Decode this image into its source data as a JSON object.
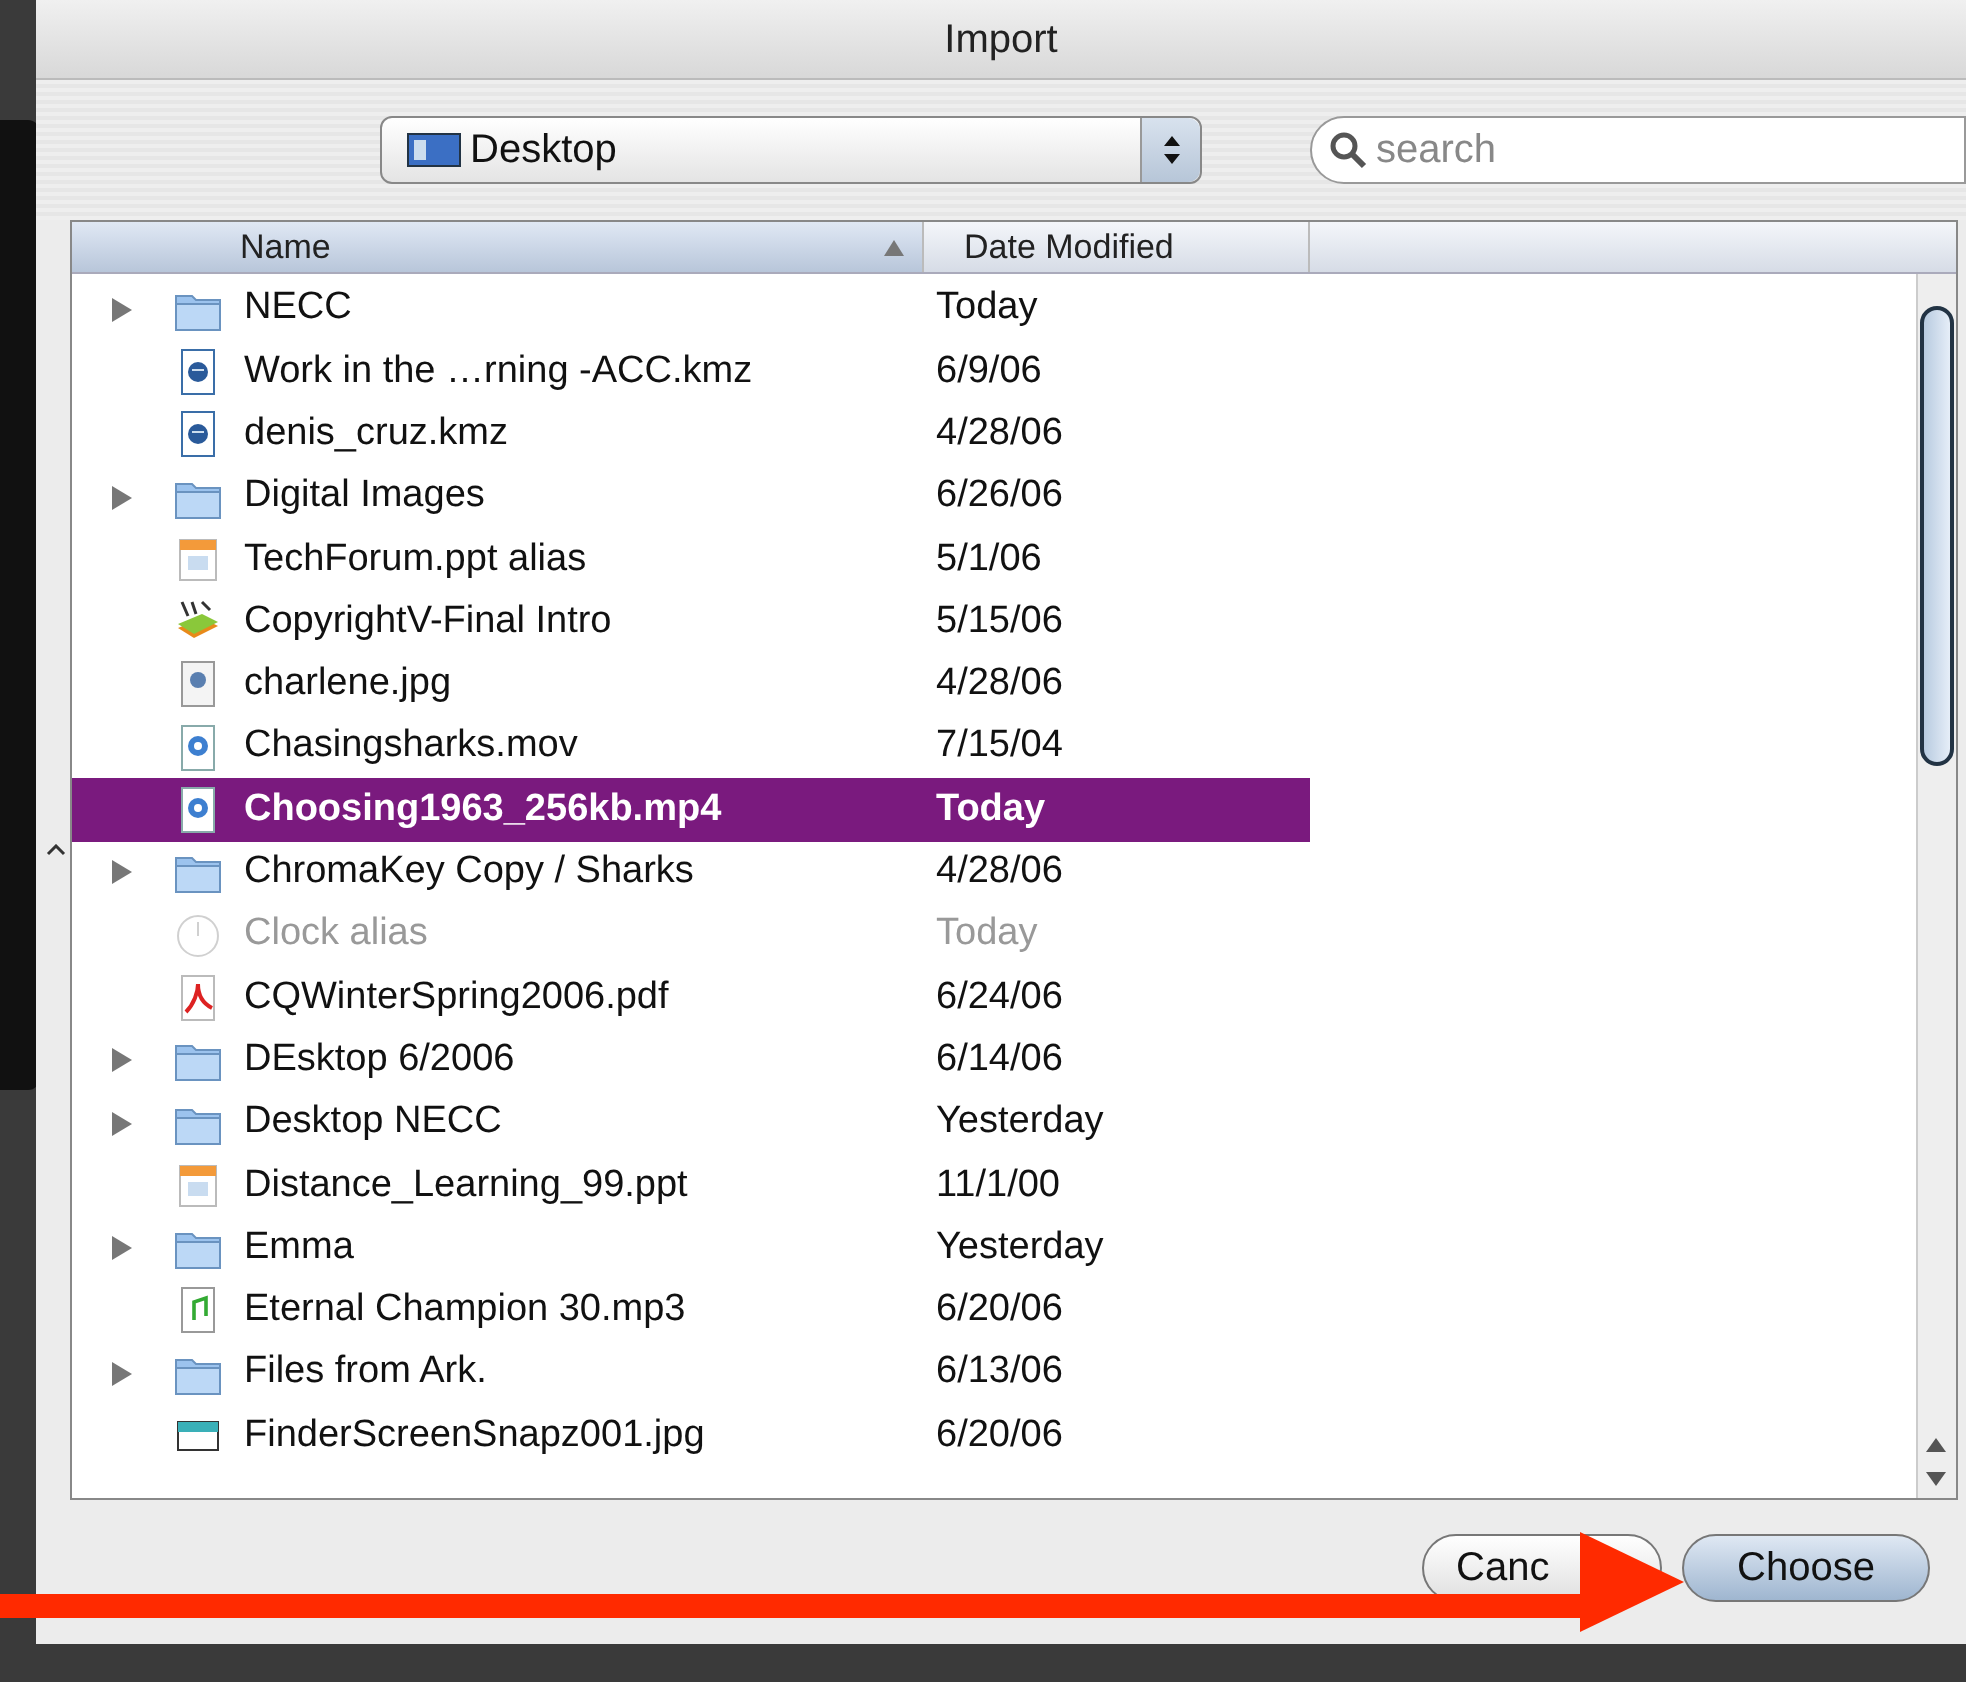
{
  "window": {
    "title": "Import"
  },
  "location": {
    "value": "Desktop"
  },
  "search": {
    "placeholder": "search"
  },
  "table": {
    "columns": [
      {
        "label": "Name",
        "sorted": true
      },
      {
        "label": "Date Modified",
        "sorted": false
      }
    ],
    "rows": [
      {
        "name": "NECC",
        "date": "Today",
        "kind": "folder",
        "expandable": true,
        "selected": false,
        "disabled": false
      },
      {
        "name": "Work in the …rning -ACC.kmz",
        "date": "6/9/06",
        "kind": "kmz",
        "expandable": false,
        "selected": false,
        "disabled": false
      },
      {
        "name": "denis_cruz.kmz",
        "date": "4/28/06",
        "kind": "kmz",
        "expandable": false,
        "selected": false,
        "disabled": false
      },
      {
        "name": "Digital Images",
        "date": "6/26/06",
        "kind": "folder",
        "expandable": true,
        "selected": false,
        "disabled": false
      },
      {
        "name": "TechForum.ppt alias",
        "date": "5/1/06",
        "kind": "slides",
        "expandable": false,
        "selected": false,
        "disabled": false
      },
      {
        "name": "CopyrightV-Final Intro",
        "date": "5/15/06",
        "kind": "app",
        "expandable": false,
        "selected": false,
        "disabled": false
      },
      {
        "name": "charlene.jpg",
        "date": "4/28/06",
        "kind": "image",
        "expandable": false,
        "selected": false,
        "disabled": false
      },
      {
        "name": "Chasingsharks.mov",
        "date": "7/15/04",
        "kind": "movie",
        "expandable": false,
        "selected": false,
        "disabled": false
      },
      {
        "name": "Choosing1963_256kb.mp4",
        "date": "Today",
        "kind": "movie",
        "expandable": false,
        "selected": true,
        "disabled": false
      },
      {
        "name": "ChromaKey Copy / Sharks",
        "date": "4/28/06",
        "kind": "folder",
        "expandable": true,
        "selected": false,
        "disabled": false
      },
      {
        "name": "Clock alias",
        "date": "Today",
        "kind": "clock",
        "expandable": false,
        "selected": false,
        "disabled": true
      },
      {
        "name": "CQWinterSpring2006.pdf",
        "date": "6/24/06",
        "kind": "pdf",
        "expandable": false,
        "selected": false,
        "disabled": false
      },
      {
        "name": "DEsktop 6/2006",
        "date": "6/14/06",
        "kind": "folder",
        "expandable": true,
        "selected": false,
        "disabled": false
      },
      {
        "name": "Desktop NECC",
        "date": "Yesterday",
        "kind": "folder",
        "expandable": true,
        "selected": false,
        "disabled": false
      },
      {
        "name": "Distance_Learning_99.ppt",
        "date": "11/1/00",
        "kind": "slides",
        "expandable": false,
        "selected": false,
        "disabled": false
      },
      {
        "name": "Emma",
        "date": "Yesterday",
        "kind": "folder",
        "expandable": true,
        "selected": false,
        "disabled": false
      },
      {
        "name": "Eternal Champion 30.mp3",
        "date": "6/20/06",
        "kind": "audio",
        "expandable": false,
        "selected": false,
        "disabled": false
      },
      {
        "name": "Files from Ark.",
        "date": "6/13/06",
        "kind": "folder",
        "expandable": true,
        "selected": false,
        "disabled": false
      },
      {
        "name": "FinderScreenSnapz001.jpg",
        "date": "6/20/06",
        "kind": "screenshot",
        "expandable": false,
        "selected": false,
        "disabled": false
      }
    ]
  },
  "buttons": [
    {
      "label": "Canc",
      "default": false
    },
    {
      "label": "Choose",
      "default": true
    }
  ]
}
